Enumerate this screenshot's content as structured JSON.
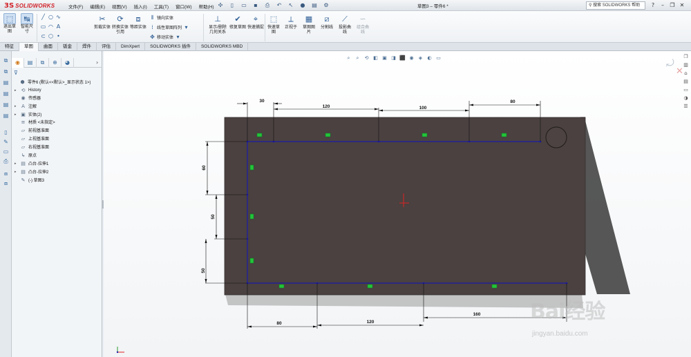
{
  "app": {
    "logo_mark": "3S",
    "logo_text": "SOLIDWORKS",
    "doc_title": "草图3 – 零件6 *"
  },
  "menu": [
    "文件(F)",
    "编辑(E)",
    "视图(V)",
    "插入(I)",
    "工具(T)",
    "窗口(W)",
    "帮助(H)"
  ],
  "help": {
    "search_placeholder": "搜索 SOLIDWORKS 帮助"
  },
  "ribbon": {
    "exit_sketch": "退出草图",
    "smart_dim": "智能尺寸",
    "trim": "剪裁实体",
    "convert": "转换实体引用",
    "offset": "等距实体",
    "mirror": "镜向实体",
    "linear_pattern": "线性草图阵列",
    "move": "移动实体",
    "display_relations": "显示/删除几何关系",
    "repair": "修复草图",
    "quick_snap": "快速捕捉",
    "rapid_sketch": "快速草图",
    "normal_to": "正视于",
    "sketch_picture": "草图图片",
    "split_line": "分割线",
    "project_curve": "投影曲线",
    "composite_curve": "组合曲线"
  },
  "tabs": [
    {
      "label": "特征",
      "active": false
    },
    {
      "label": "草图",
      "active": true
    },
    {
      "label": "曲面",
      "active": false
    },
    {
      "label": "钣金",
      "active": false
    },
    {
      "label": "焊件",
      "active": false
    },
    {
      "label": "评估",
      "active": false
    },
    {
      "label": "DimXpert",
      "active": false
    },
    {
      "label": "SOLIDWORKS 插件",
      "active": false
    },
    {
      "label": "SOLIDWORKS MBD",
      "active": false
    }
  ],
  "tree": [
    {
      "label": "零件6 (默认<<默认>_显示状态 1>)",
      "icon": "part-icon",
      "glyph": "⬢",
      "exp": ""
    },
    {
      "label": "History",
      "icon": "history-icon",
      "glyph": "⟲",
      "exp": "▸"
    },
    {
      "label": "传感器",
      "icon": "sensor-icon",
      "glyph": "◉",
      "exp": ""
    },
    {
      "label": "注解",
      "icon": "annotation-icon",
      "glyph": "A",
      "exp": "▸"
    },
    {
      "label": "实体(2)",
      "icon": "solid-bodies-icon",
      "glyph": "▣",
      "exp": "▸"
    },
    {
      "label": "材质 <未指定>",
      "icon": "material-icon",
      "glyph": "≡",
      "exp": ""
    },
    {
      "label": "前视基准面",
      "icon": "plane-icon",
      "glyph": "▱",
      "exp": ""
    },
    {
      "label": "上视基准面",
      "icon": "plane-icon",
      "glyph": "▱",
      "exp": ""
    },
    {
      "label": "右视基准面",
      "icon": "plane-icon",
      "glyph": "▱",
      "exp": ""
    },
    {
      "label": "原点",
      "icon": "origin-icon",
      "glyph": "↳",
      "exp": ""
    },
    {
      "label": "凸台-拉伸1",
      "icon": "extrude-icon",
      "glyph": "▤",
      "exp": "▸"
    },
    {
      "label": "凸台-拉伸2",
      "icon": "extrude-icon",
      "glyph": "▤",
      "exp": "▸"
    },
    {
      "label": "(-) 草图3",
      "icon": "sketch-icon",
      "glyph": "✎",
      "exp": ""
    }
  ],
  "dimensions": {
    "top": [
      "30",
      "120",
      "100",
      "80"
    ],
    "left": [
      "60",
      "50",
      "50"
    ],
    "bottom": [
      "80",
      "120",
      "160"
    ]
  },
  "watermark": {
    "logo": "Bai经验",
    "url": "jingyan.baidu.com"
  },
  "colors": {
    "plate": "#4a4140",
    "plate_edge": "#363030",
    "sketch_line": "#1a1aa8",
    "relation_marker": "#22c43a",
    "dimension": "#111111"
  }
}
